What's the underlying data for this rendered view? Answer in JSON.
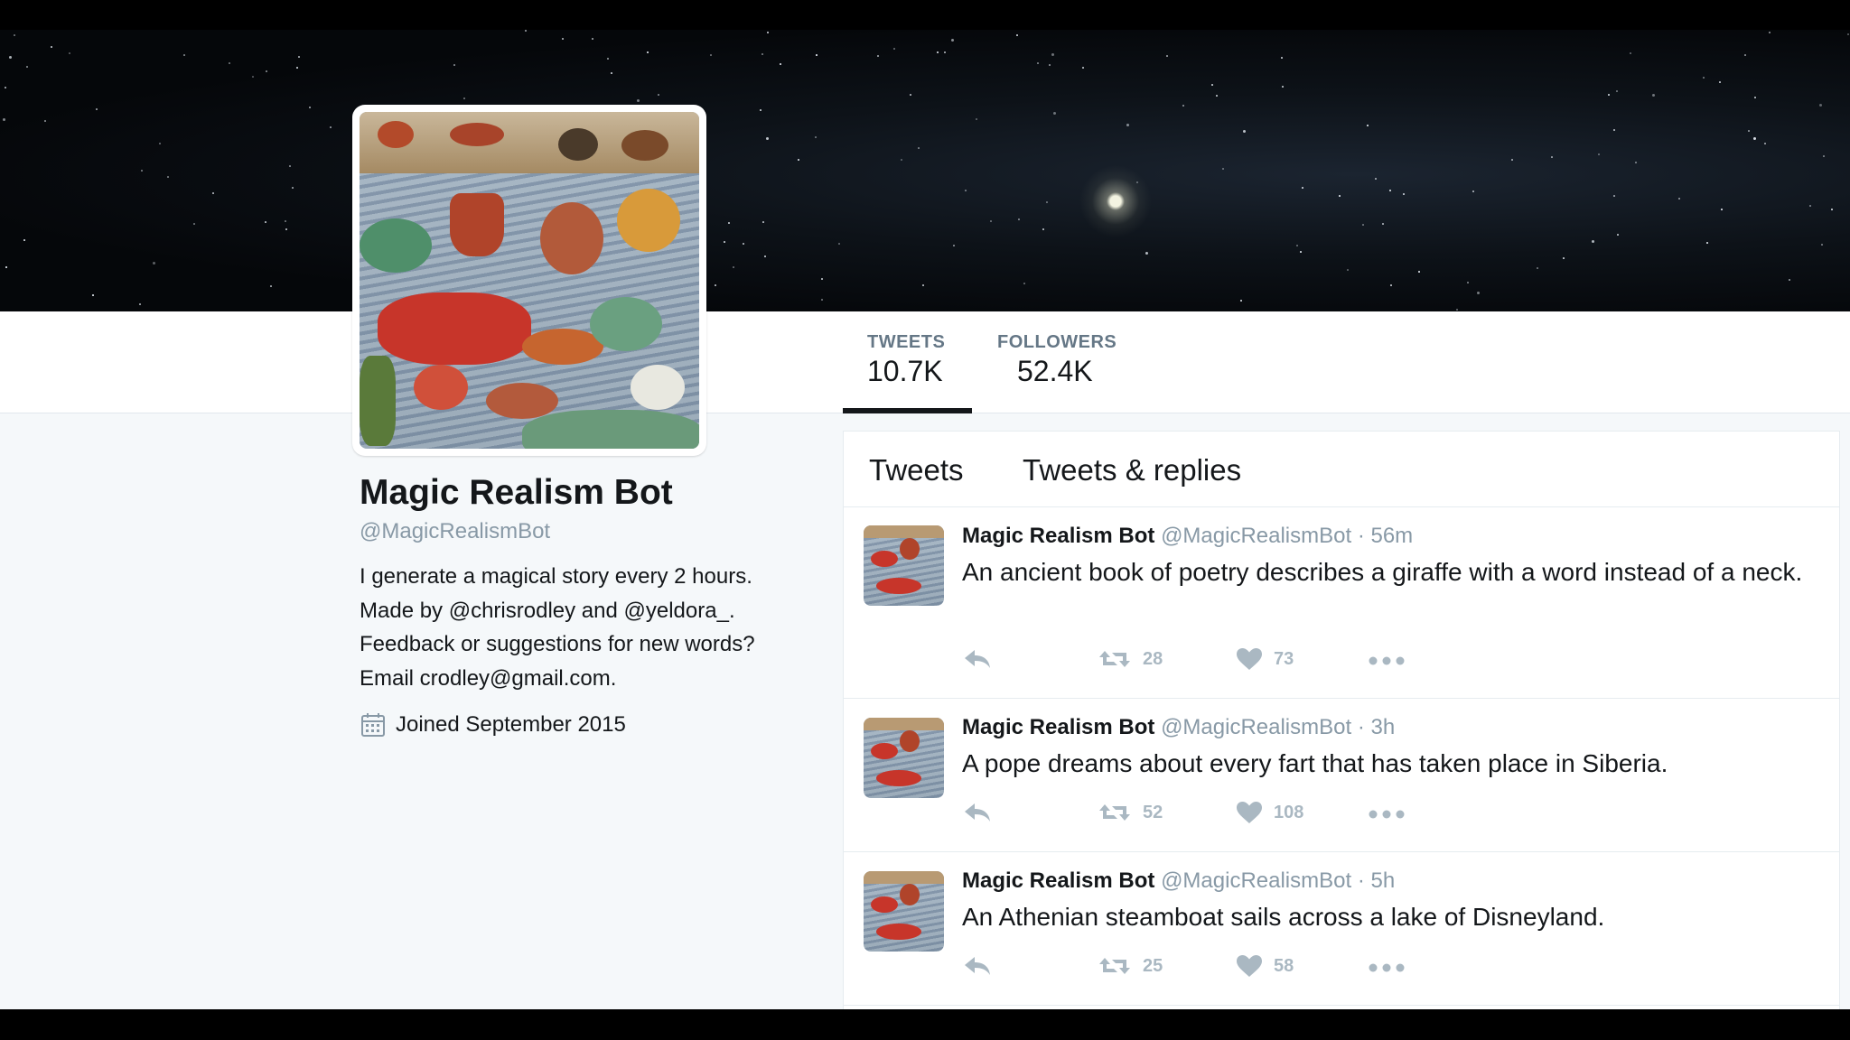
{
  "profile": {
    "name": "Magic Realism Bot",
    "handle": "@MagicRealismBot",
    "bio_line1": "I generate a magical story every 2 hours.",
    "bio_made_by": "Made by ",
    "mention1": "@chrisrodley",
    "bio_and": " and ",
    "mention2": "@yeldora_",
    "bio_period": ".",
    "bio_line3": "Feedback or suggestions for new words?",
    "bio_line4": "Email crodley@gmail.com.",
    "joined": "Joined September 2015"
  },
  "stats": {
    "tweets_label": "TWEETS",
    "tweets_value": "10.7K",
    "followers_label": "FOLLOWERS",
    "followers_value": "52.4K"
  },
  "tabs": {
    "tweets": "Tweets",
    "tweets_replies": "Tweets & replies"
  },
  "tweets": [
    {
      "name": "Magic Realism Bot",
      "handle": "@MagicRealismBot",
      "sep": " · ",
      "time": "56m",
      "text": "An ancient book of poetry describes a giraffe with a word instead of a neck.",
      "retweets": "28",
      "likes": "73"
    },
    {
      "name": "Magic Realism Bot",
      "handle": "@MagicRealismBot",
      "sep": " · ",
      "time": "3h",
      "text": "A pope dreams about every fart that has taken place in Siberia.",
      "retweets": "52",
      "likes": "108"
    },
    {
      "name": "Magic Realism Bot",
      "handle": "@MagicRealismBot",
      "sep": " · ",
      "time": "5h",
      "text": "An Athenian steamboat sails across a lake of Disneyland.",
      "retweets": "25",
      "likes": "58"
    }
  ],
  "icons": {
    "reply": "reply-icon",
    "retweet": "retweet-icon",
    "like": "heart-icon",
    "more": "more-icon",
    "calendar": "calendar-icon"
  },
  "colors": {
    "text": "#14171a",
    "muted": "#8899a6",
    "action": "#aab8c2",
    "background": "#f5f8fa"
  }
}
